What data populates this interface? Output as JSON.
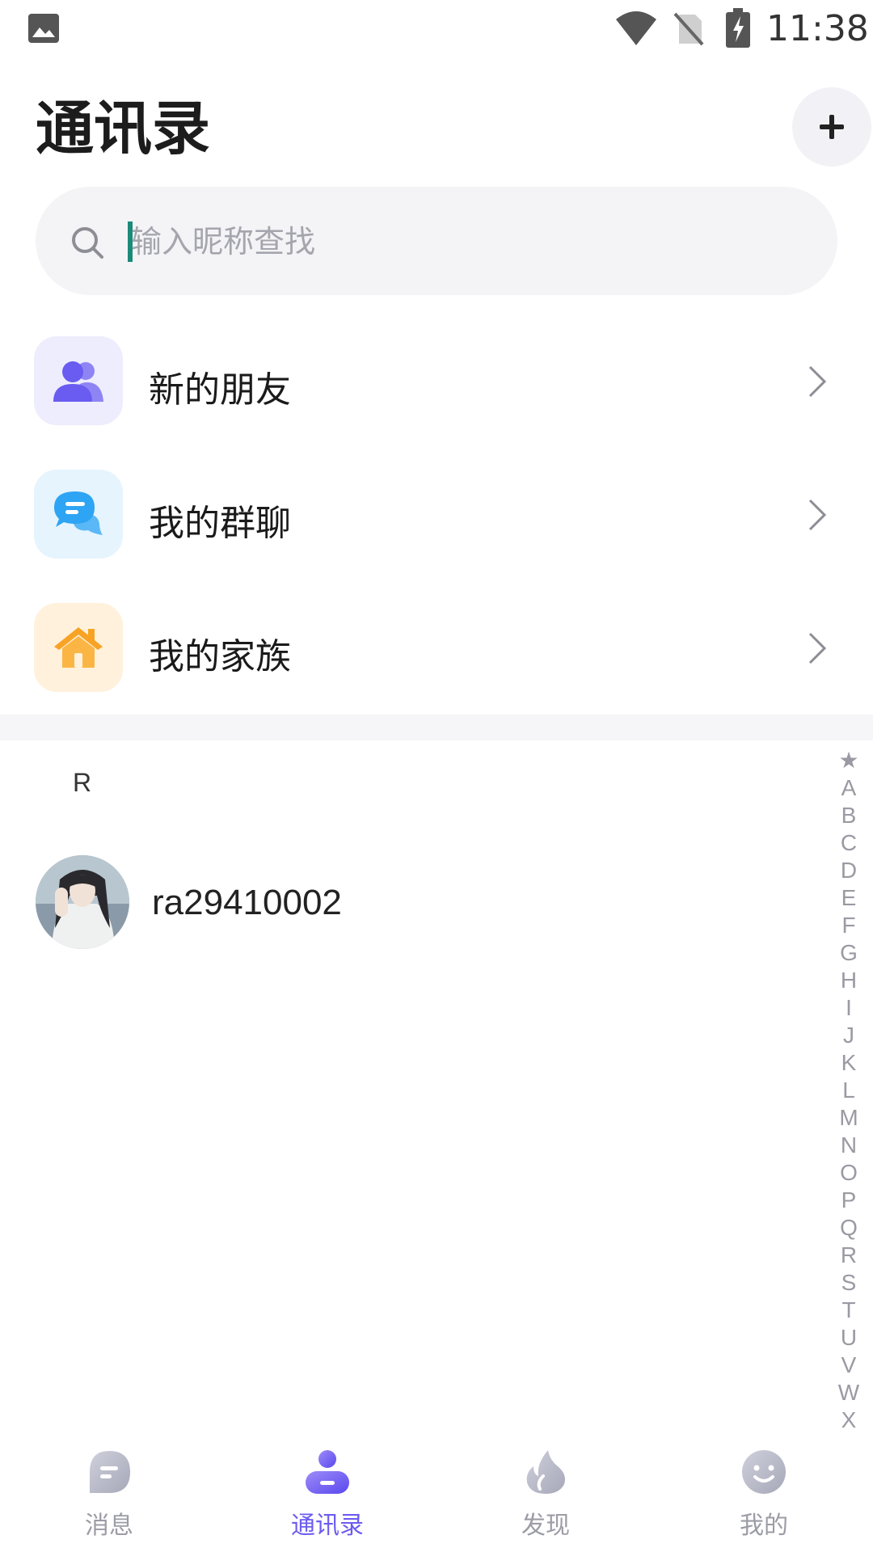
{
  "status_bar": {
    "time": "11:38"
  },
  "header": {
    "title": "通讯录"
  },
  "search": {
    "placeholder": "输入昵称查找"
  },
  "menu": [
    {
      "label": "新的朋友",
      "icon": "users-icon",
      "icon_bg": "#eeedfd",
      "icon_color": "#6a5cf0"
    },
    {
      "label": "我的群聊",
      "icon": "chat-bubbles-icon",
      "icon_bg": "#e6f4fe",
      "icon_color": "#2ea4f4"
    },
    {
      "label": "我的家族",
      "icon": "house-icon",
      "icon_bg": "#fff1dc",
      "icon_color": "#f8a324"
    }
  ],
  "contacts": {
    "section_letter": "R",
    "items": [
      {
        "name": "ra29410002"
      }
    ]
  },
  "index_bar": [
    "★",
    "A",
    "B",
    "C",
    "D",
    "E",
    "F",
    "G",
    "H",
    "I",
    "J",
    "K",
    "L",
    "M",
    "N",
    "O",
    "P",
    "Q",
    "R",
    "S",
    "T",
    "U",
    "V",
    "W",
    "X"
  ],
  "bottom_nav": [
    {
      "label": "消息",
      "active": false
    },
    {
      "label": "通讯录",
      "active": true
    },
    {
      "label": "发现",
      "active": false
    },
    {
      "label": "我的",
      "active": false
    }
  ],
  "colors": {
    "accent": "#6c5cf0",
    "inactive": "#9c9ca6"
  }
}
